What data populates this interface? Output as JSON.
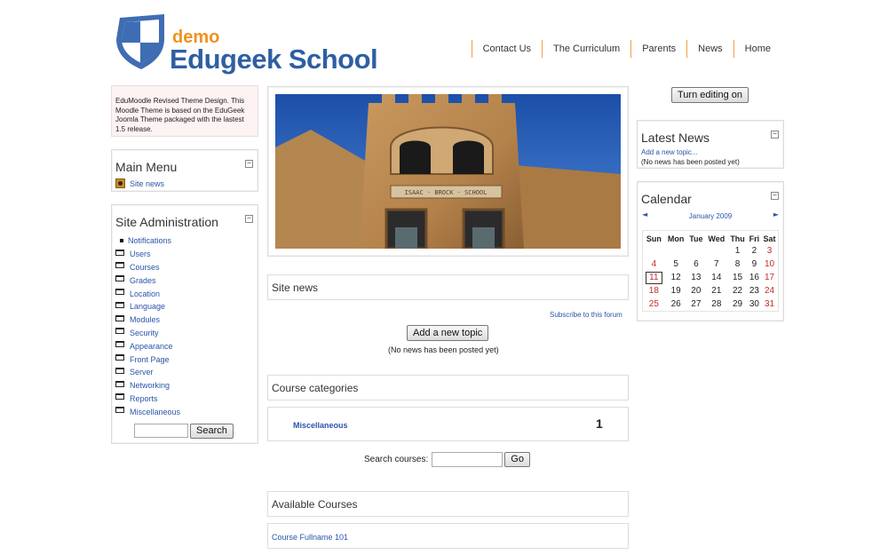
{
  "header": {
    "logo_demo": "demo",
    "logo_name": "Edugeek School",
    "nav": [
      "Contact Us",
      "The Curriculum",
      "Parents",
      "News",
      "Home"
    ]
  },
  "intro": {
    "text": "EduMoodle Revised Theme Design. This Moodle Theme is based on the EduGeek Joomla Theme packaged with the lastest 1.5 release."
  },
  "main_menu": {
    "title": "Main Menu",
    "toggle": "−",
    "item": "Site news"
  },
  "site_admin": {
    "title": "Site Administration",
    "toggle": "−",
    "items": [
      "Notifications",
      "Users",
      "Courses",
      "Grades",
      "Location",
      "Language",
      "Modules",
      "Security",
      "Appearance",
      "Front Page",
      "Server",
      "Networking",
      "Reports",
      "Miscellaneous"
    ],
    "search_button": "Search"
  },
  "center": {
    "site_news_title": "Site news",
    "subscribe": "Subscribe to this forum",
    "add_topic": "Add a new topic",
    "no_news": "(No news has been posted yet)",
    "categories_title": "Course categories",
    "category_name": "Miscellaneous",
    "category_count": "1",
    "search_courses_label": "Search courses:",
    "go_button": "Go",
    "available_title": "Available Courses",
    "course_link": "Course Fullname 101",
    "banner_sign": "ISAAC · BROCK · SCHOOL"
  },
  "right": {
    "edit_button": "Turn editing on",
    "latest_news_title": "Latest News",
    "latest_toggle": "−",
    "latest_add": "Add a new topic...",
    "latest_none": "(No news has been posted yet)",
    "calendar_title": "Calendar",
    "calendar_toggle": "−",
    "prev": "◄",
    "next": "►",
    "month": "January 2009",
    "days": [
      "Sun",
      "Mon",
      "Tue",
      "Wed",
      "Thu",
      "Fri",
      "Sat"
    ],
    "weeks": [
      [
        "",
        "",
        "",
        "",
        "1",
        "2",
        "3"
      ],
      [
        "4",
        "5",
        "6",
        "7",
        "8",
        "9",
        "10"
      ],
      [
        "11",
        "12",
        "13",
        "14",
        "15",
        "16",
        "17"
      ],
      [
        "18",
        "19",
        "20",
        "21",
        "22",
        "23",
        "24"
      ],
      [
        "25",
        "26",
        "27",
        "28",
        "29",
        "30",
        "31"
      ]
    ],
    "today": "11"
  },
  "colors": {
    "link": "#2a55a8",
    "brand_blue": "#2f5fa3",
    "brand_orange": "#f0911f",
    "weekend": "#c62a2a"
  }
}
